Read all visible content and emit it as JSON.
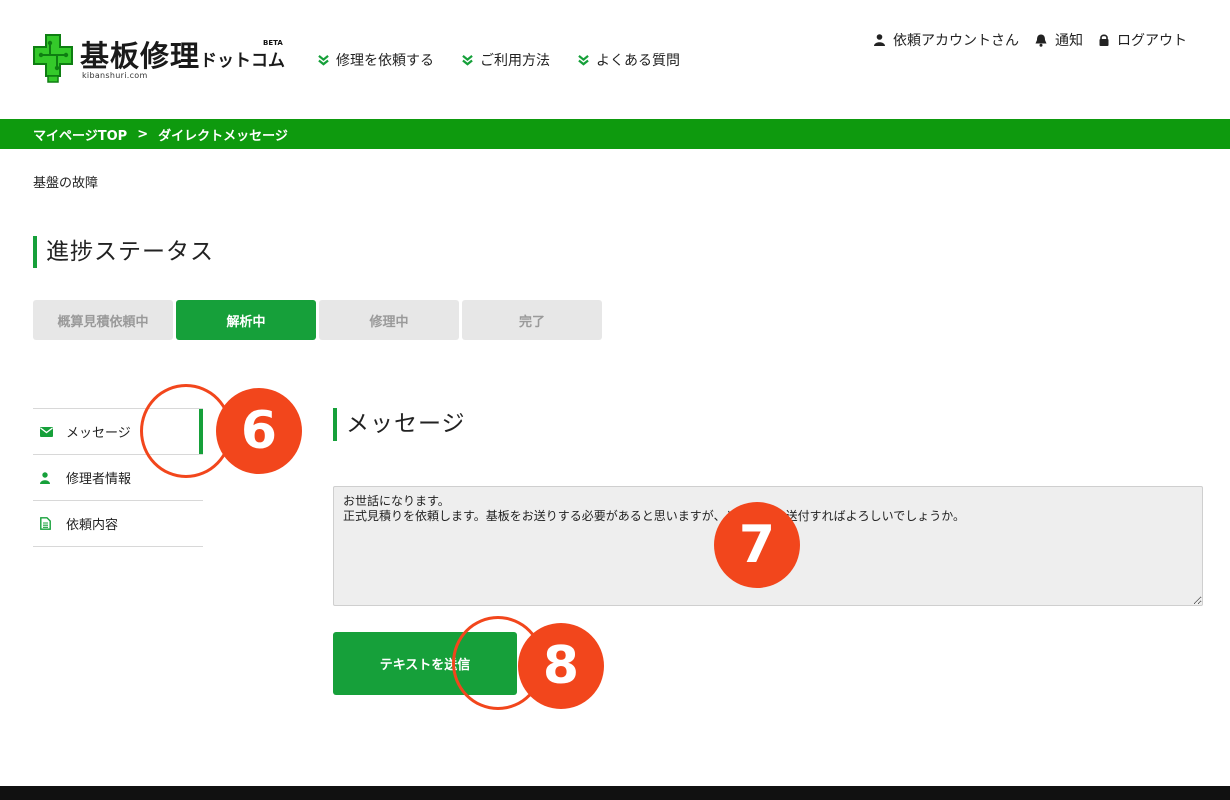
{
  "brand": {
    "name": "基板修理",
    "suffix": "ドットコム",
    "beta": "BETA",
    "domain": "kibanshuri.com",
    "accent_color": "#16a03a",
    "bar_color": "#0e9a0e"
  },
  "nav": {
    "items": [
      {
        "label": "修理を依頼する"
      },
      {
        "label": "ご利用方法"
      },
      {
        "label": "よくある質問"
      }
    ]
  },
  "user_nav": {
    "account": "依頼アカウントさん",
    "notifications": "通知",
    "logout": "ログアウト"
  },
  "breadcrumb": {
    "items": [
      "マイページTOP",
      "ダイレクトメッセージ"
    ],
    "separator": ">"
  },
  "case_title": "基盤の故障",
  "progress": {
    "heading": "進捗ステータス",
    "steps": [
      {
        "label": "概算見積依頼中",
        "active": false
      },
      {
        "label": "解析中",
        "active": true
      },
      {
        "label": "修理中",
        "active": false
      },
      {
        "label": "完了",
        "active": false
      }
    ]
  },
  "side_menu": {
    "items": [
      {
        "label": "メッセージ",
        "icon": "envelope-icon",
        "active": true
      },
      {
        "label": "修理者情報",
        "icon": "user-icon",
        "active": false
      },
      {
        "label": "依頼内容",
        "icon": "document-icon",
        "active": false
      }
    ]
  },
  "message": {
    "heading": "メッセージ",
    "text": "お世話になります。\n正式見積りを依頼します。基板をお送りする必要があると思いますが、どのように送付すればよろしいでしょうか。",
    "send_label": "テキストを送信"
  },
  "annotations": {
    "markers": [
      "6",
      "7",
      "8"
    ],
    "color": "#f2461c"
  }
}
